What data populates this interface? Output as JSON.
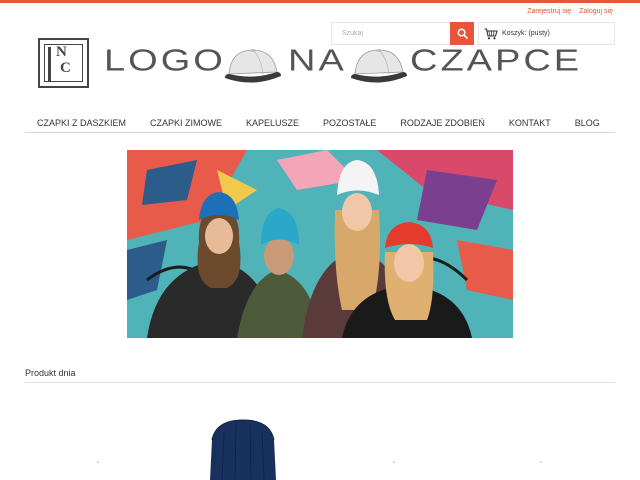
{
  "header": {
    "register_link": "Zarejestruj się",
    "login_link": "Zaloguj się",
    "search_placeholder": "Szukaj",
    "cart_label": "Koszyk: (pusty)",
    "logo_words": [
      "LOGO",
      "NA",
      "CZAPCE"
    ],
    "logo_mark_letters": [
      "N",
      "C"
    ]
  },
  "nav": {
    "items": [
      "CZAPKI Z DASZKIEM",
      "CZAPKI ZIMOWE",
      "KAPELUSZE",
      "POZOSTAŁE",
      "RODZAJE ZDOBIEŃ",
      "KONTAKT",
      "BLOG"
    ]
  },
  "main": {
    "section_title": "Produkt dnia"
  },
  "colors": {
    "accent": "#e8553b",
    "text": "#333333",
    "logo_gray": "#555555"
  },
  "icons": [
    "search-icon",
    "cart-icon"
  ]
}
